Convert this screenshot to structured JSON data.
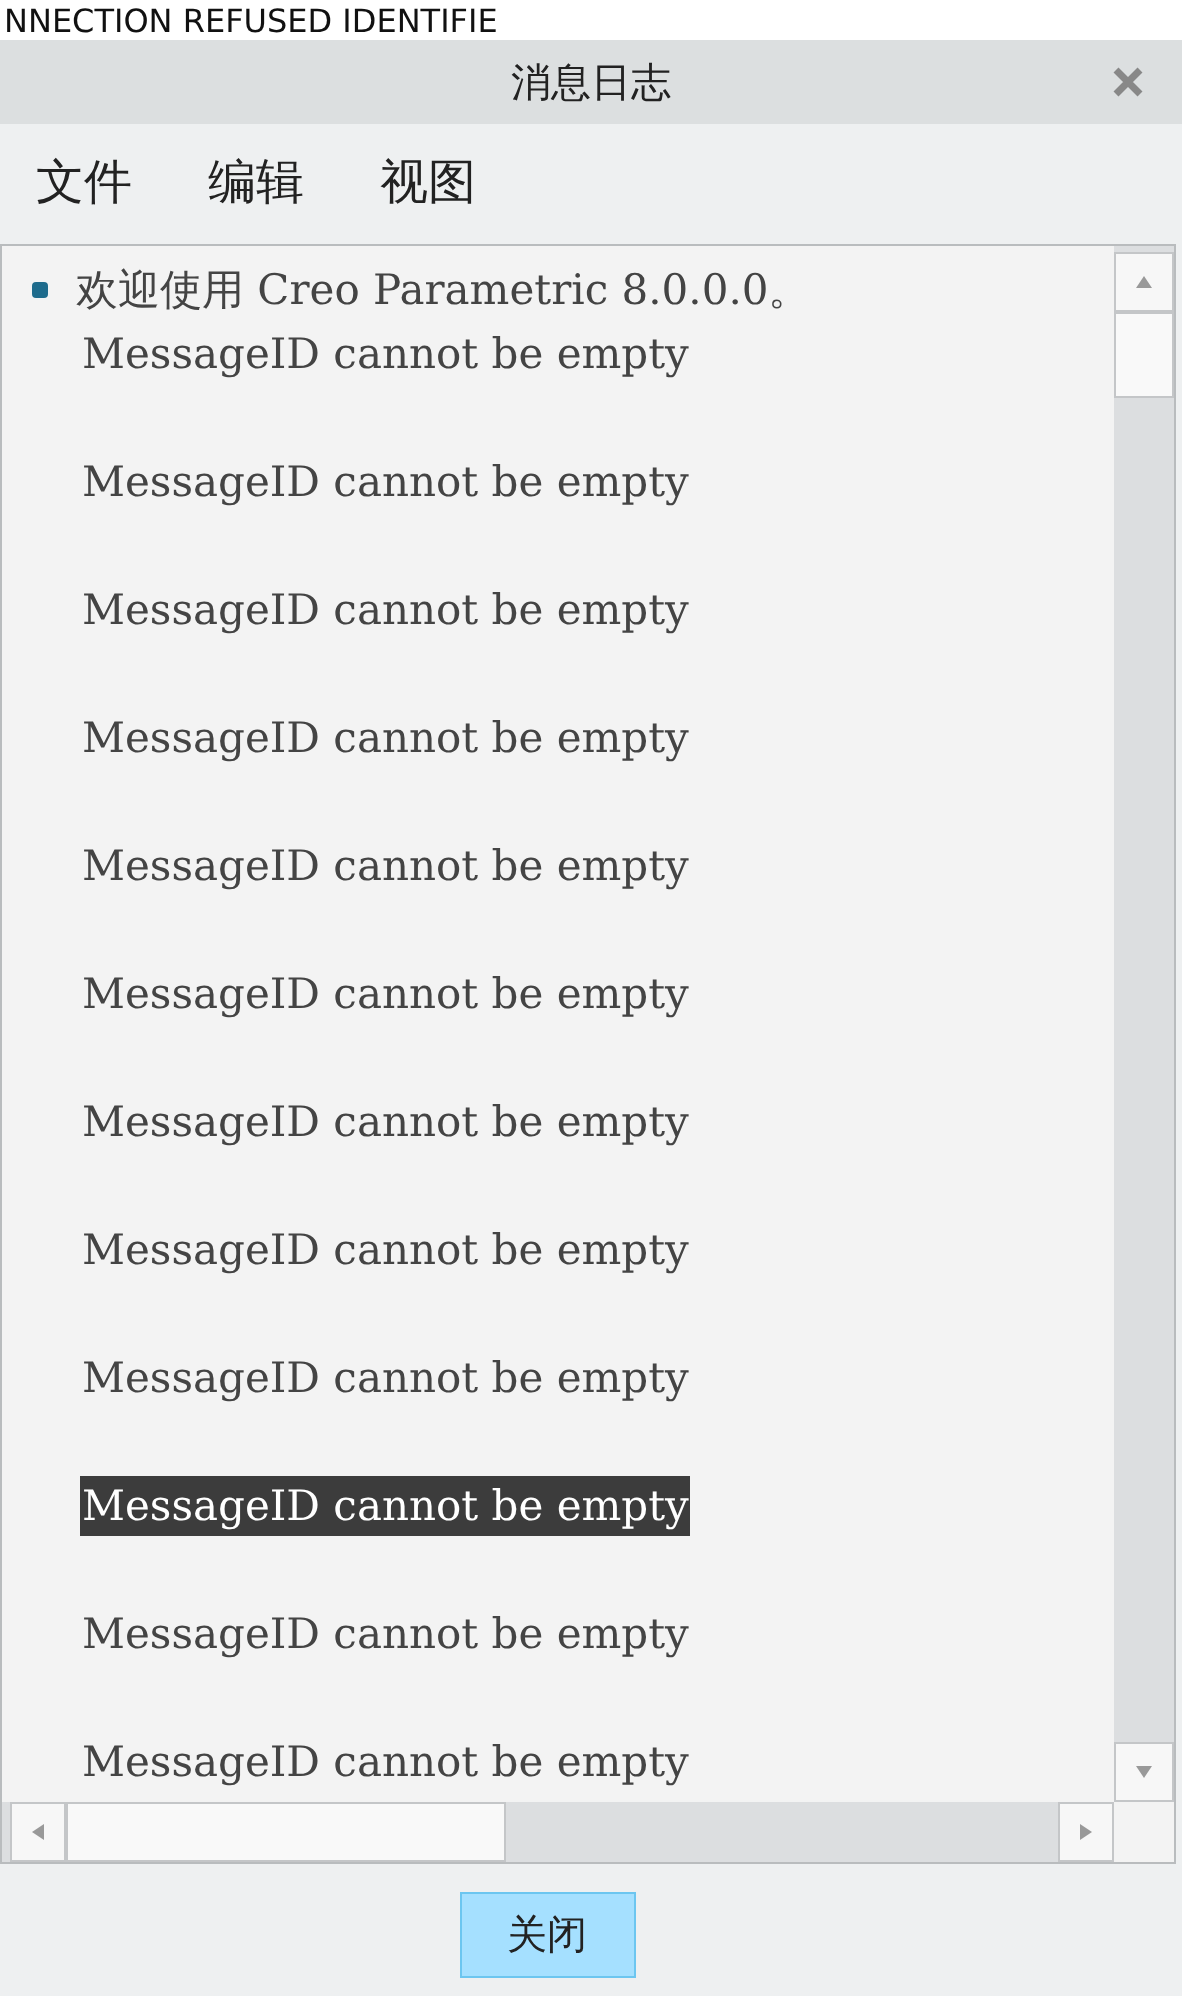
{
  "background_text": "NNECTION REFUSED IDENTIFIE",
  "window": {
    "title": "消息日志"
  },
  "menu": [
    {
      "label": "文件"
    },
    {
      "label": "编辑"
    },
    {
      "label": "视图"
    }
  ],
  "log": [
    {
      "kind": "info",
      "text": "欢迎使用 Creo Parametric 8.0.0.0。",
      "selected": false
    },
    {
      "kind": "message",
      "text": "MessageID cannot be empty",
      "selected": false
    },
    {
      "kind": "message",
      "text": "MessageID cannot be empty",
      "selected": false
    },
    {
      "kind": "message",
      "text": "MessageID cannot be empty",
      "selected": false
    },
    {
      "kind": "message",
      "text": "MessageID cannot be empty",
      "selected": false
    },
    {
      "kind": "message",
      "text": "MessageID cannot be empty",
      "selected": false
    },
    {
      "kind": "message",
      "text": "MessageID cannot be empty",
      "selected": false
    },
    {
      "kind": "message",
      "text": "MessageID cannot be empty",
      "selected": false
    },
    {
      "kind": "message",
      "text": "MessageID cannot be empty",
      "selected": false
    },
    {
      "kind": "message",
      "text": "MessageID cannot be empty",
      "selected": false
    },
    {
      "kind": "message",
      "text": "MessageID cannot be empty",
      "selected": true
    },
    {
      "kind": "message",
      "text": "MessageID cannot be empty",
      "selected": false
    },
    {
      "kind": "message",
      "text": "MessageID cannot be empty",
      "selected": false
    }
  ],
  "buttons": [
    {
      "label": "关闭"
    }
  ]
}
